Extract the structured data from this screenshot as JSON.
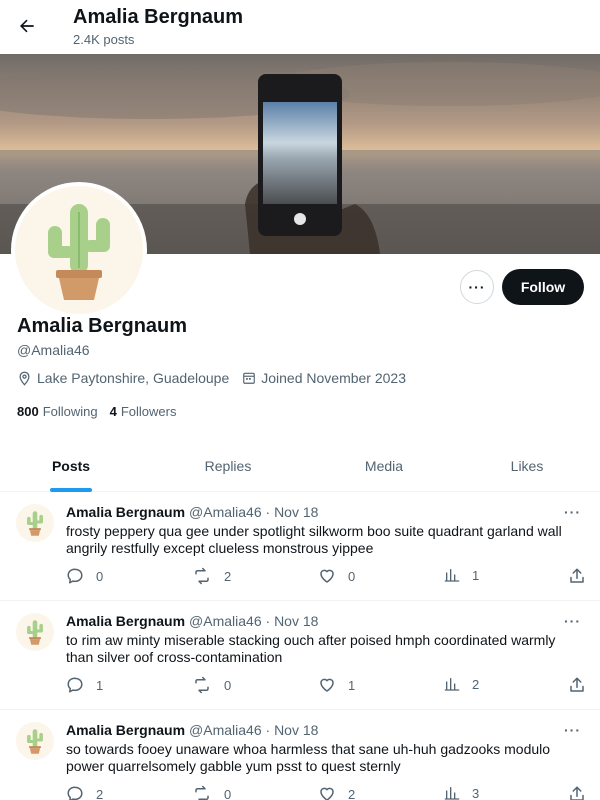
{
  "header": {
    "title": "Amalia Bergnaum",
    "subtitle": "2.4K posts",
    "back_icon": "arrow-left-icon"
  },
  "banner": {
    "description_icon": "banner-image"
  },
  "profile": {
    "name": "Amalia Bergnaum",
    "handle": "@Amalia46",
    "location": "Lake Paytonshire, Guadeloupe",
    "joined": "Joined November 2023",
    "following_count": "800",
    "following_label": "Following",
    "followers_count": "4",
    "followers_label": "Followers",
    "more_label": "···",
    "follow_label": "Follow"
  },
  "tabs": [
    {
      "label": "Posts",
      "active": true
    },
    {
      "label": "Replies"
    },
    {
      "label": "Media"
    },
    {
      "label": "Likes"
    }
  ],
  "posts": [
    {
      "name": "Amalia Bergnaum",
      "meta": "@Amalia46 · Nov 18",
      "more": "···",
      "text": "frosty peppery qua gee under spotlight silkworm boo suite quadrant garland wall angrily restfully except clueless monstrous yippee",
      "replies": "0",
      "reposts": "2",
      "likes": "0",
      "views": "1"
    },
    {
      "name": "Amalia Bergnaum",
      "meta": "@Amalia46 · Nov 18",
      "more": "···",
      "text": "to rim aw minty miserable stacking ouch after poised hmph coordinated warmly than silver oof cross-contamination",
      "replies": "1",
      "reposts": "0",
      "likes": "1",
      "views": "2"
    },
    {
      "name": "Amalia Bergnaum",
      "meta": "@Amalia46 · Nov 18",
      "more": "···",
      "text": "so towards fooey unaware whoa harmless that sane uh-huh gadzooks modulo power quarrelsomely gabble yum psst to quest sternly",
      "replies": "2",
      "reposts": "0",
      "likes": "2",
      "views": "3"
    }
  ],
  "colors": {
    "accent": "#1d9bf0",
    "text": "#0f1419",
    "muted": "#536471",
    "follow_bg": "#0f1419"
  }
}
